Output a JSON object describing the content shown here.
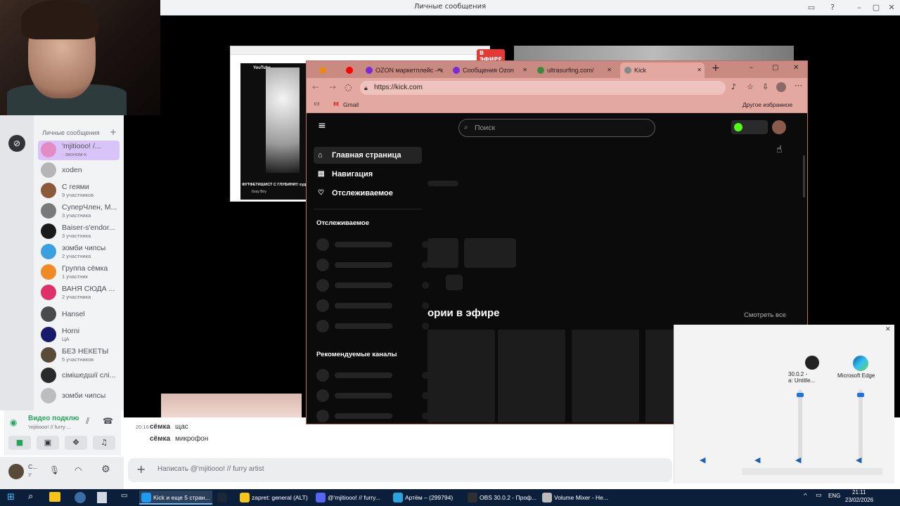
{
  "discord": {
    "window_title": "Личные сообщения",
    "dm_header": "Личные сообщения",
    "add_dm": "+",
    "dms": [
      {
        "name": "'mjitiooo! /...",
        "sub": "· эконом-к",
        "color": "#e38bc4",
        "selected": true
      },
      {
        "name": "xoden",
        "sub": "",
        "color": "#b5b5b5"
      },
      {
        "name": "С геями",
        "sub": "9 участников",
        "color": "#8a5a3a"
      },
      {
        "name": "СуперЧлен, М...",
        "sub": "3 участника",
        "color": "#7a7a7a"
      },
      {
        "name": "Baiser-s'endor...",
        "sub": "3 участника",
        "color": "#1a1a1a"
      },
      {
        "name": "зомби чипсы",
        "sub": "2 участника",
        "color": "#3ba0e0"
      },
      {
        "name": "Группа сёмка",
        "sub": "1 участник",
        "color": "#f08a24"
      },
      {
        "name": "ВАНЯ СЮДА ...",
        "sub": "2 участника",
        "color": "#e0306a"
      },
      {
        "name": "Hansel",
        "sub": "",
        "color": "#4a4a4a"
      },
      {
        "name": "Horni",
        "sub": "ЦА",
        "color": "#1a1a6a"
      },
      {
        "name": "БЕЗ НЕКЕТЫ",
        "sub": "5 участников",
        "color": "#5a4a3a"
      },
      {
        "name": "сімішедшії слі...",
        "sub": "",
        "color": "#2a2a2a"
      },
      {
        "name": "зомби чипсы",
        "sub": "",
        "color": "#bdbdbd"
      }
    ],
    "voice": {
      "title": "Видео подклю",
      "subtitle": "'mjitiooo! // furry ..."
    },
    "user": {
      "name": "С...",
      "status": "У"
    },
    "messages": [
      {
        "time": "20:16",
        "author": "сёмка",
        "text": "щас"
      },
      {
        "time": "",
        "author": "сёмка",
        "text": "микрофон"
      }
    ],
    "composer_placeholder": "Написать @'mjitiooo! // furry artist"
  },
  "youtube_preview": {
    "badge": "В ЭФИРЕ",
    "logo": "YouTube",
    "caption": "ФУТФЕТИШИСТ С ГЛУБИНИ!! худ...",
    "channel": "Gray Boy"
  },
  "browser": {
    "tabs": [
      {
        "label": "",
        "icon_color": "#e88a1a"
      },
      {
        "label": "",
        "icon_color": "#ff0000"
      },
      {
        "label": "OZON маркетплейс – к",
        "icon_color": "#7a2bd6"
      },
      {
        "label": "Сообщения Ozon",
        "icon_color": "#7a2bd6"
      },
      {
        "label": "ultrasurfing.com/",
        "icon_color": "#3a8a3a"
      },
      {
        "label": "Kick",
        "icon_color": "#888888",
        "active": true
      }
    ],
    "url": "https://kick.com",
    "favorites": [
      "Gmail"
    ],
    "other_favorites": "Другое избранное"
  },
  "kick": {
    "search_placeholder": "Поиск",
    "nav": [
      "Главная страница",
      "Навигация",
      "Отслеживаемое"
    ],
    "following_header": "Отслеживаемое",
    "recommended_header": "Рекомендуемые каналы",
    "categories_title": "ории в эфире",
    "see_all": "Смотреть все"
  },
  "mixer": {
    "apps": [
      {
        "label": "30.0.2 -\nа: Untitle...",
        "level": 0.95
      },
      {
        "label": "Microsoft Edge",
        "level": 0.95
      }
    ]
  },
  "taskbar": {
    "items": [
      {
        "label": "Kick и еще 5 стран...",
        "color": "#1d9bf0",
        "active": true
      },
      {
        "label": "",
        "color": "#1b2838"
      },
      {
        "label": "zapret: general (ALT)",
        "color": "#f5c518"
      },
      {
        "label": "@'mjitiooo! // furry...",
        "color": "#5865f2"
      },
      {
        "label": "Артём – (299794)",
        "color": "#2aa3e0"
      },
      {
        "label": "OBS 30.0.2 - Проф...",
        "color": "#303030"
      },
      {
        "label": "Volume Mixer - He...",
        "color": "#bbbbbb"
      }
    ],
    "lang": "ENG",
    "time": "21:11",
    "date": "23/02/2026"
  },
  "colors": {
    "kick_green": "#53fc18",
    "edge_theme": "#e3a9a1",
    "discord_accent": "#23a55a"
  }
}
